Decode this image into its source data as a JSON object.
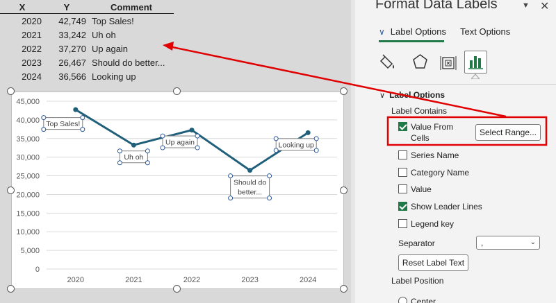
{
  "sheet": {
    "headers": [
      "X",
      "Y",
      "Comment"
    ],
    "rows": [
      {
        "x": "2020",
        "y": "42,749",
        "comment": "Top Sales!"
      },
      {
        "x": "2021",
        "y": "33,242",
        "comment": "Uh oh"
      },
      {
        "x": "2022",
        "y": "37,270",
        "comment": "Up again"
      },
      {
        "x": "2023",
        "y": "26,467",
        "comment": "Should do better..."
      },
      {
        "x": "2024",
        "y": "36,566",
        "comment": "Looking up"
      }
    ]
  },
  "chart_data": {
    "type": "line",
    "x": [
      "2020",
      "2021",
      "2022",
      "2023",
      "2024"
    ],
    "series": [
      {
        "values": [
          42749,
          33242,
          37270,
          26467,
          36566
        ]
      }
    ],
    "data_labels": [
      "Top Sales!",
      "Uh oh",
      "Up again",
      "Should do better...",
      "Looking up"
    ],
    "y_ticks": [
      "0",
      "5,000",
      "10,000",
      "15,000",
      "20,000",
      "25,000",
      "30,000",
      "35,000",
      "40,000",
      "45,000"
    ],
    "ylim": [
      0,
      45000
    ],
    "grid": true,
    "legend": "none",
    "line_color": "#1f5f7a"
  },
  "pane": {
    "title": "Format Data Labels",
    "tabs": {
      "label_options": "Label Options",
      "text_options": "Text Options"
    },
    "icons": [
      "fill-line-icon",
      "effects-icon",
      "size-properties-icon",
      "label-options-chart-icon"
    ],
    "section_title": "Label Options",
    "label_contains": "Label Contains",
    "options": [
      {
        "label": "Value From Cells",
        "checked": true
      },
      {
        "label": "Series Name",
        "checked": false
      },
      {
        "label": "Category Name",
        "checked": false
      },
      {
        "label": "Value",
        "checked": false
      },
      {
        "label": "Show Leader Lines",
        "checked": true
      },
      {
        "label": "Legend key",
        "checked": false
      }
    ],
    "value_from_cells_line1": "Value From",
    "value_from_cells_line2": "Cells",
    "select_range_button": "Select Range...",
    "separator_label": "Separator",
    "separator_value": ",",
    "reset_button": "Reset Label Text",
    "label_position": "Label Position",
    "position_center": "Center"
  },
  "colors": {
    "accent": "#1f7a48",
    "highlight": "#e00000"
  }
}
